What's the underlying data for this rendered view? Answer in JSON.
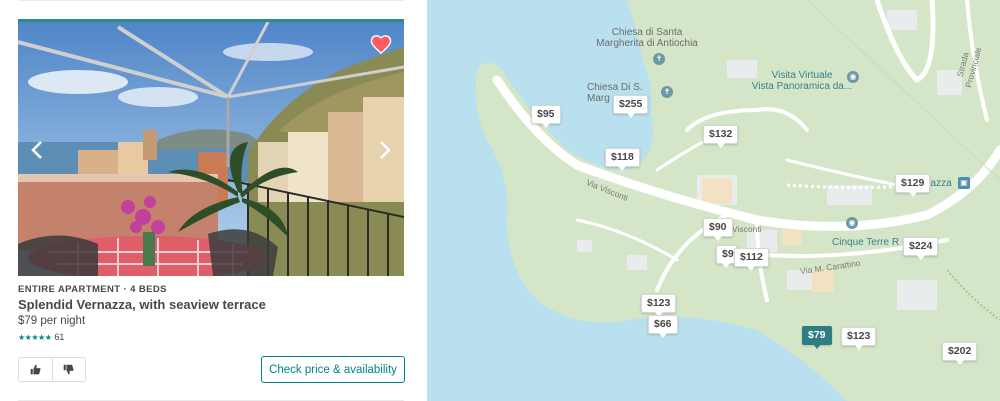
{
  "listing": {
    "type_label": "ENTIRE APARTMENT · 4 BEDS",
    "title": "Splendid Vernazza, with seaview terrace",
    "price": "$79 per night",
    "stars": "★★★★★",
    "review_count": "61",
    "cta_label": "Check price & availability",
    "favorite": true
  },
  "icons": {
    "heart": "heart-icon",
    "prev": "chevron-left-icon",
    "next": "chevron-right-icon",
    "thumbs_up": "thumbs-up-icon",
    "thumbs_down": "thumbs-down-icon"
  },
  "colors": {
    "accent": "#008489",
    "heart": "#ff5a5f",
    "active_pin": "#2e7d84",
    "water": "#b9e0ee",
    "land": "#d4e6c7"
  },
  "map": {
    "labels": {
      "chiesa_santa": "Chiesa di Santa\nMargherita di Antiochia",
      "chiesa_s": "Chiesa Di S.\nMarg",
      "visita": "Visita Virtuale\nVista Panoramica da...",
      "cinque_terre": "Cinque Terre R",
      "via_visconti": "Via Visconti",
      "visconti": "Visconti",
      "via_carattino": "Via M. Carattino",
      "strada_provinciale": "Strada Provinciale",
      "nazza": "nazza"
    },
    "pins": [
      {
        "label": "$95"
      },
      {
        "label": "$255"
      },
      {
        "label": "$132"
      },
      {
        "label": "$118"
      },
      {
        "label": "$129"
      },
      {
        "label": "$90"
      },
      {
        "label": "$9"
      },
      {
        "label": "$112"
      },
      {
        "label": "$224"
      },
      {
        "label": "$123"
      },
      {
        "label": "$66"
      },
      {
        "label": "$79",
        "active": true
      },
      {
        "label": "$123"
      },
      {
        "label": "$202"
      }
    ]
  }
}
